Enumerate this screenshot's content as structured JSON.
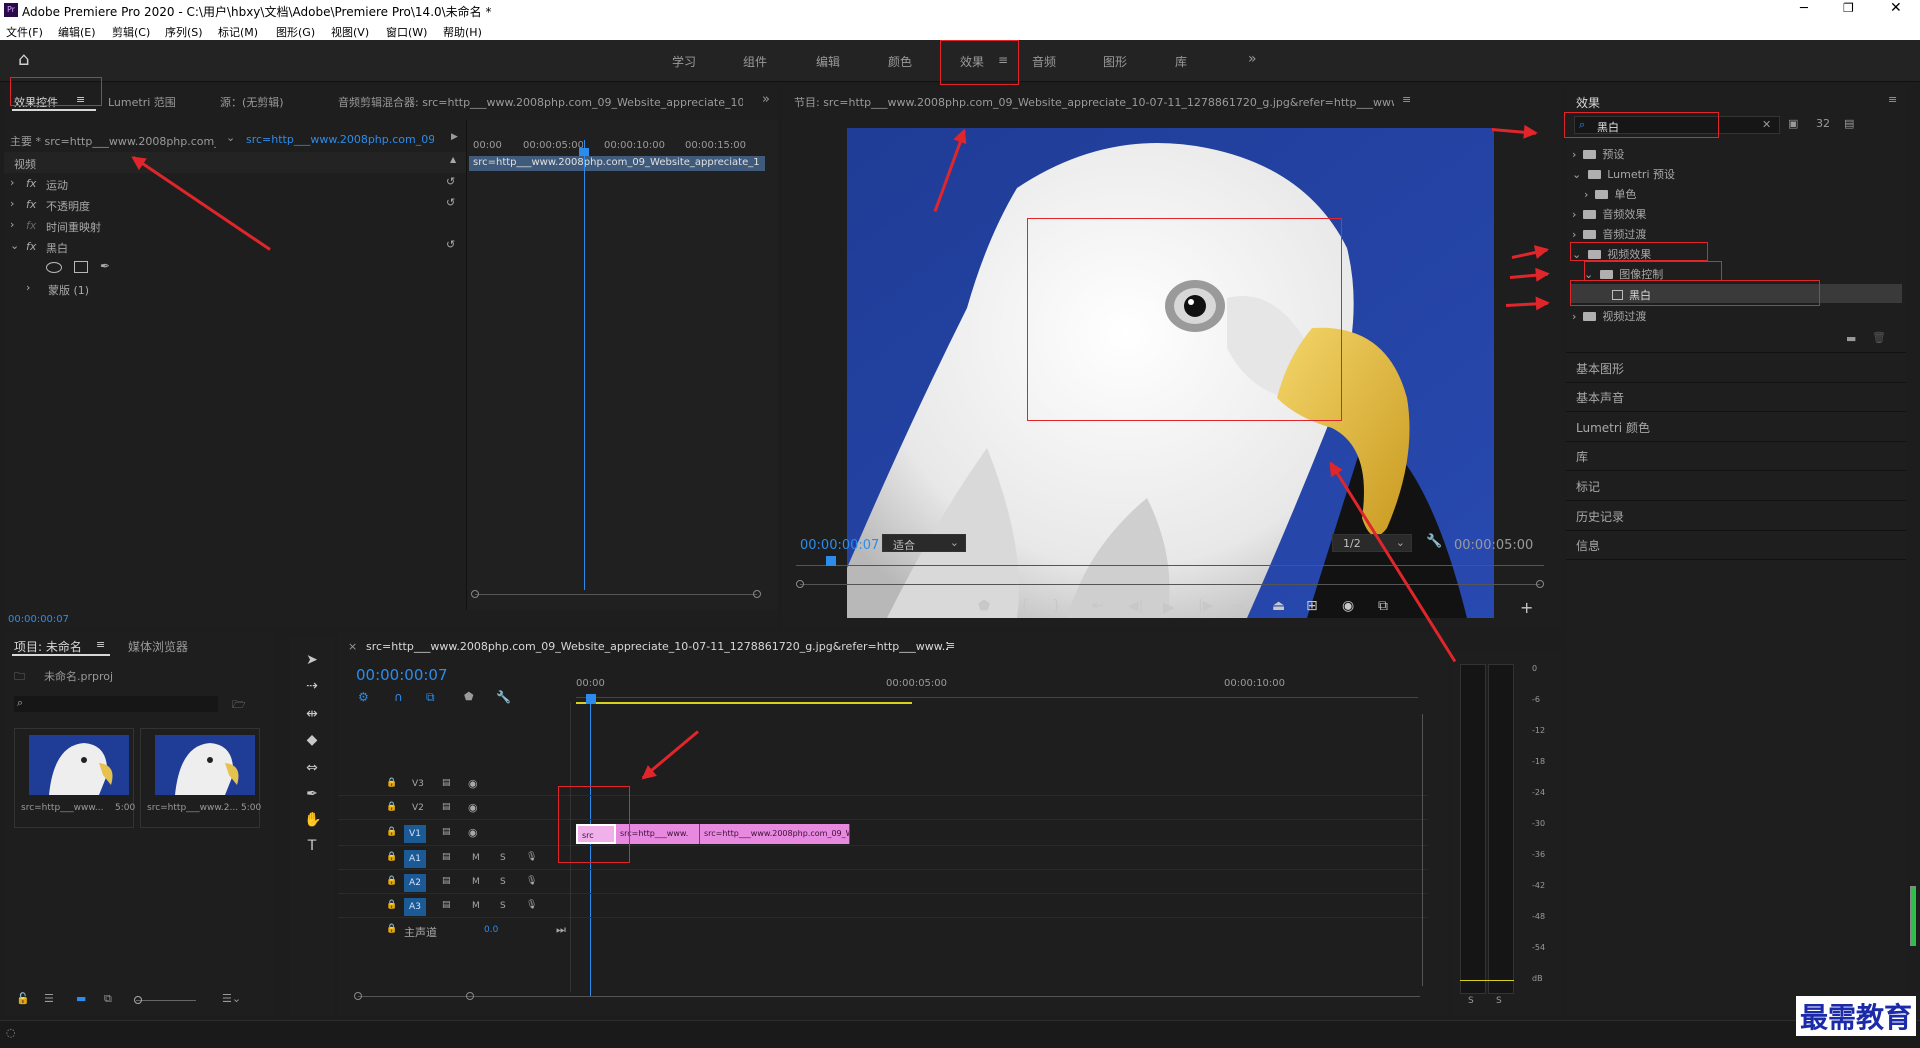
{
  "app": {
    "title": "Adobe Premiere Pro 2020 - C:\\用户\\hbxy\\文档\\Adobe\\Premiere Pro\\14.0\\未命名 *"
  },
  "menu": [
    "文件(F)",
    "编辑(E)",
    "剪辑(C)",
    "序列(S)",
    "标记(M)",
    "图形(G)",
    "视图(V)",
    "窗口(W)",
    "帮助(H)"
  ],
  "workspaces": [
    "学习",
    "组件",
    "编辑",
    "颜色",
    "效果",
    "音频",
    "图形",
    "库"
  ],
  "effect_controls": {
    "tabs": [
      "效果控件",
      "Lumetri 范围",
      "源：(无剪辑)",
      "音频剪辑混合器: src=http___www.2008php.com_09_Website_appreciate_10-("
    ],
    "master": "主要 * src=http___www.2008php.com_...",
    "clip": "src=http___www.2008php.com_09_...",
    "times": [
      "00:00",
      "00:00:05:00",
      "00:00:10:00",
      "00:00:15:00"
    ],
    "clip_bar": "src=http___www.2008php.com_09_Website_appreciate_1",
    "section": "视频",
    "rows": [
      "运动",
      "不透明度",
      "时间重映射",
      "黑白",
      "蒙版 (1)"
    ],
    "timecode": "00:00:00:07"
  },
  "program": {
    "title": "节目: src=http___www.2008php.com_09_Website_appreciate_10-07-11_1278861720_g.jpg&refer=http___www.2008php",
    "timecode": "00:00:00:07",
    "fit": "适合",
    "res": "1/2",
    "duration": "00:00:05:00"
  },
  "project": {
    "tabs": [
      "项目: 未命名",
      "媒体浏览器"
    ],
    "file": "未命名.prproj",
    "items": [
      {
        "name": "src=http___www...",
        "dur": "5:00"
      },
      {
        "name": "src=http___www.2...",
        "dur": "5:00"
      }
    ]
  },
  "sequence": {
    "title": "src=http___www.2008php.com_09_Website_appreciate_10-07-11_1278861720_g.jpg&refer=http___www.2008php",
    "timecode": "00:00:00:07",
    "ruler": [
      "00:00",
      "00:00:05:00",
      "00:00:10:00"
    ],
    "video_tracks": [
      "V3",
      "V2",
      "V1"
    ],
    "audio_tracks": [
      "A1",
      "A2",
      "A3"
    ],
    "master": "主声道",
    "master_val": "0.0",
    "clips": [
      "src",
      "src=http___www.",
      "src=http___www.2008php.com_09_W"
    ]
  },
  "meter": {
    "scale": [
      "0",
      "-6",
      "-12",
      "-18",
      "-24",
      "-30",
      "-36",
      "-42",
      "-48",
      "-54",
      "dB"
    ],
    "solo": [
      "S",
      "S"
    ]
  },
  "effects": {
    "title": "效果",
    "search": "黑白",
    "tree": [
      "预设",
      "Lumetri 预设",
      "单色",
      "音频效果",
      "音频过渡",
      "视频效果",
      "图像控制",
      "黑白",
      "视频过渡"
    ],
    "panels": [
      "基本图形",
      "基本声音",
      "Lumetri 颜色",
      "库",
      "标记",
      "历史记录",
      "信息"
    ]
  },
  "watermark": "最需教育"
}
